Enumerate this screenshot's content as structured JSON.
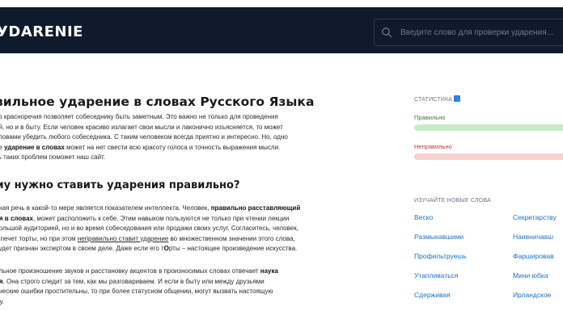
{
  "header": {
    "logo": "УDARENIE",
    "search_placeholder": "Введите слово для проверки ударения..."
  },
  "main": {
    "title": "вильное ударение в словах Русского Языка",
    "intro": [
      {
        "t": "во красноречия позволяет собеседнику быть заметным. Это важно не только для проведения"
      },
      {
        "br": true
      },
      {
        "t": "ий, но и в быту. Если человек красиво излагает свои мысли и лаконично изъясняется, то может"
      },
      {
        "br": true
      },
      {
        "t": "словами убедить любого собеседника. С таким человеком всегда приятно и интересно. Но, одно"
      },
      {
        "br": true
      },
      {
        "t": "ое "
      },
      {
        "b": "ударение в словах"
      },
      {
        "t": " может на нет свести всю красоту голоса и точность выражения мысли."
      },
      {
        "br": true
      },
      {
        "t": "ть таких проблем поможет наш сайт."
      }
    ],
    "subtitle": "му нужно ставить ударения правильно?",
    "para2": [
      {
        "t": "ьная речь в какой-то мере является показателем интеллекта. Человек, "
      },
      {
        "b": "правильно расставляющий"
      },
      {
        "br": true
      },
      {
        "b": "ия в словах"
      },
      {
        "t": ", может расположить к себе. Этим навыком пользуются не только при чтении лекции"
      },
      {
        "br": true
      },
      {
        "t": "большой аудиторией, но и во время собеседования или продажи своих услуг. Согласитесь, человек,"
      },
      {
        "br": true
      },
      {
        "t": "й печет торты, но при этом "
      },
      {
        "u": "неправильно ставит ударение"
      },
      {
        "t": " во множественном значении этого слова,"
      },
      {
        "br": true
      },
      {
        "t": " будет признан экспертом в своем деле. Даже если его т"
      },
      {
        "b": "О"
      },
      {
        "t": "рты – настоящее произведение искусства."
      }
    ],
    "para3": [
      {
        "t": "ильное произношение звуков и расстановку акцентов в произносимых словах отвечает "
      },
      {
        "b": "наука"
      },
      {
        "br": true
      },
      {
        "b": "ия"
      },
      {
        "t": ". Она строго следит за тем, как мы разговариваем. И если в быту или между друзьями"
      },
      {
        "br": true
      },
      {
        "t": "ические ошибки простительны, то при более статусном общении, могут вызвать настоящую"
      },
      {
        "br": true
      },
      {
        "t": "му."
      }
    ]
  },
  "sidebar": {
    "stats_label": "СТАТИСТИКА",
    "correct_label": "Правильно",
    "wrong_label": "Неправильно",
    "learn_label": "ИЗУЧАЙТЕ НОВЫЕ СЛОВА",
    "words": [
      "Веско",
      "Секретарству",
      "Размыкавшими",
      "Наивничавш",
      "Профильтруешь",
      "Фаршировав",
      "Утапливаться",
      "Мини юбка",
      "Сдерживая",
      "Ирландское"
    ]
  },
  "colors": {
    "header_bg": "#0f1a2d",
    "link": "#1a73c6",
    "correct": "#2e7d32",
    "wrong": "#d32f2f",
    "correct_bar": "#c8ecc8",
    "wrong_bar": "#f8d0d0"
  }
}
